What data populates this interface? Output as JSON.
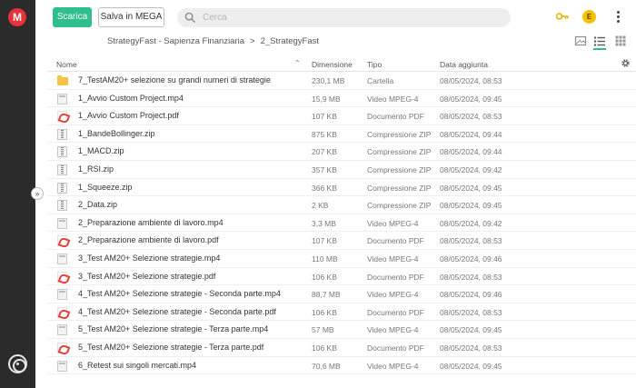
{
  "app": {
    "logo_letter": "M"
  },
  "toolbar": {
    "download_label": "Scarica",
    "save_label": "Salva in MEGA",
    "search_placeholder": "Cerca",
    "avatar_letter": "E"
  },
  "breadcrumb": {
    "items": [
      "StrategyFast - Sapienza Finanziaria",
      "2_StrategyFast"
    ],
    "separator": ">"
  },
  "table": {
    "headers": {
      "name": "Nome",
      "size": "Dimensione",
      "type": "Tipo",
      "date": "Data aggiunta"
    },
    "rows": [
      {
        "icon": "folder-icon",
        "name": "7_TestAM20+ selezione su grandi numeri di strategie",
        "size": "230,1 MB",
        "type": "Cartella",
        "date": "08/05/2024, 08:53"
      },
      {
        "icon": "video-file-icon",
        "name": "1_Avvio Custom Project.mp4",
        "size": "15,9 MB",
        "type": "Video MPEG-4",
        "date": "08/05/2024, 09:45"
      },
      {
        "icon": "pdf-file-icon",
        "name": "1_Avvio Custom Project.pdf",
        "size": "107 KB",
        "type": "Documento PDF",
        "date": "08/05/2024, 08:53"
      },
      {
        "icon": "zip-file-icon",
        "name": "1_BandeBollinger.zip",
        "size": "875 KB",
        "type": "Compressione ZIP",
        "date": "08/05/2024, 09:44"
      },
      {
        "icon": "zip-file-icon",
        "name": "1_MACD.zip",
        "size": "207 KB",
        "type": "Compressione ZIP",
        "date": "08/05/2024, 09:44"
      },
      {
        "icon": "zip-file-icon",
        "name": "1_RSI.zip",
        "size": "357 KB",
        "type": "Compressione ZIP",
        "date": "08/05/2024, 09:42"
      },
      {
        "icon": "zip-file-icon",
        "name": "1_Squeeze.zip",
        "size": "366 KB",
        "type": "Compressione ZIP",
        "date": "08/05/2024, 09:45"
      },
      {
        "icon": "zip-file-icon",
        "name": "2_Data.zip",
        "size": "2 KB",
        "type": "Compressione ZIP",
        "date": "08/05/2024, 09:45"
      },
      {
        "icon": "video-file-icon",
        "name": "2_Preparazione ambiente di lavoro.mp4",
        "size": "3,3 MB",
        "type": "Video MPEG-4",
        "date": "08/05/2024, 09:42"
      },
      {
        "icon": "pdf-file-icon",
        "name": "2_Preparazione ambiente di lavoro.pdf",
        "size": "107 KB",
        "type": "Documento PDF",
        "date": "08/05/2024, 08:53"
      },
      {
        "icon": "video-file-icon",
        "name": "3_Test AM20+ Selezione strategie.mp4",
        "size": "110 MB",
        "type": "Video MPEG-4",
        "date": "08/05/2024, 09:46"
      },
      {
        "icon": "pdf-file-icon",
        "name": "3_Test AM20+ Selezione strategie.pdf",
        "size": "106 KB",
        "type": "Documento PDF",
        "date": "08/05/2024, 08:53"
      },
      {
        "icon": "video-file-icon",
        "name": "4_Test AM20+ Selezione strategie - Seconda parte.mp4",
        "size": "88,7 MB",
        "type": "Video MPEG-4",
        "date": "08/05/2024, 09:46"
      },
      {
        "icon": "pdf-file-icon",
        "name": "4_Test AM20+ Selezione strategie - Seconda parte.pdf",
        "size": "106 KB",
        "type": "Documento PDF",
        "date": "08/05/2024, 08:53"
      },
      {
        "icon": "video-file-icon",
        "name": "5_Test AM20+ Selezione strategie - Terza parte.mp4",
        "size": "57 MB",
        "type": "Video MPEG-4",
        "date": "08/05/2024, 09:45"
      },
      {
        "icon": "pdf-file-icon",
        "name": "5_Test AM20+ Selezione strategie - Terza parte.pdf",
        "size": "106 KB",
        "type": "Documento PDF",
        "date": "08/05/2024, 08:53"
      },
      {
        "icon": "video-file-icon",
        "name": "6_Retest sui singoli mercati.mp4",
        "size": "70,6 MB",
        "type": "Video MPEG-4",
        "date": "08/05/2024, 09:45"
      }
    ]
  },
  "colors": {
    "accent": "#2fbf8c",
    "logo": "#e8313a",
    "sidebar": "#2b2b2b",
    "avatar": "#f3c300",
    "folder": "#f6c344",
    "pdf": "#e5413b"
  }
}
